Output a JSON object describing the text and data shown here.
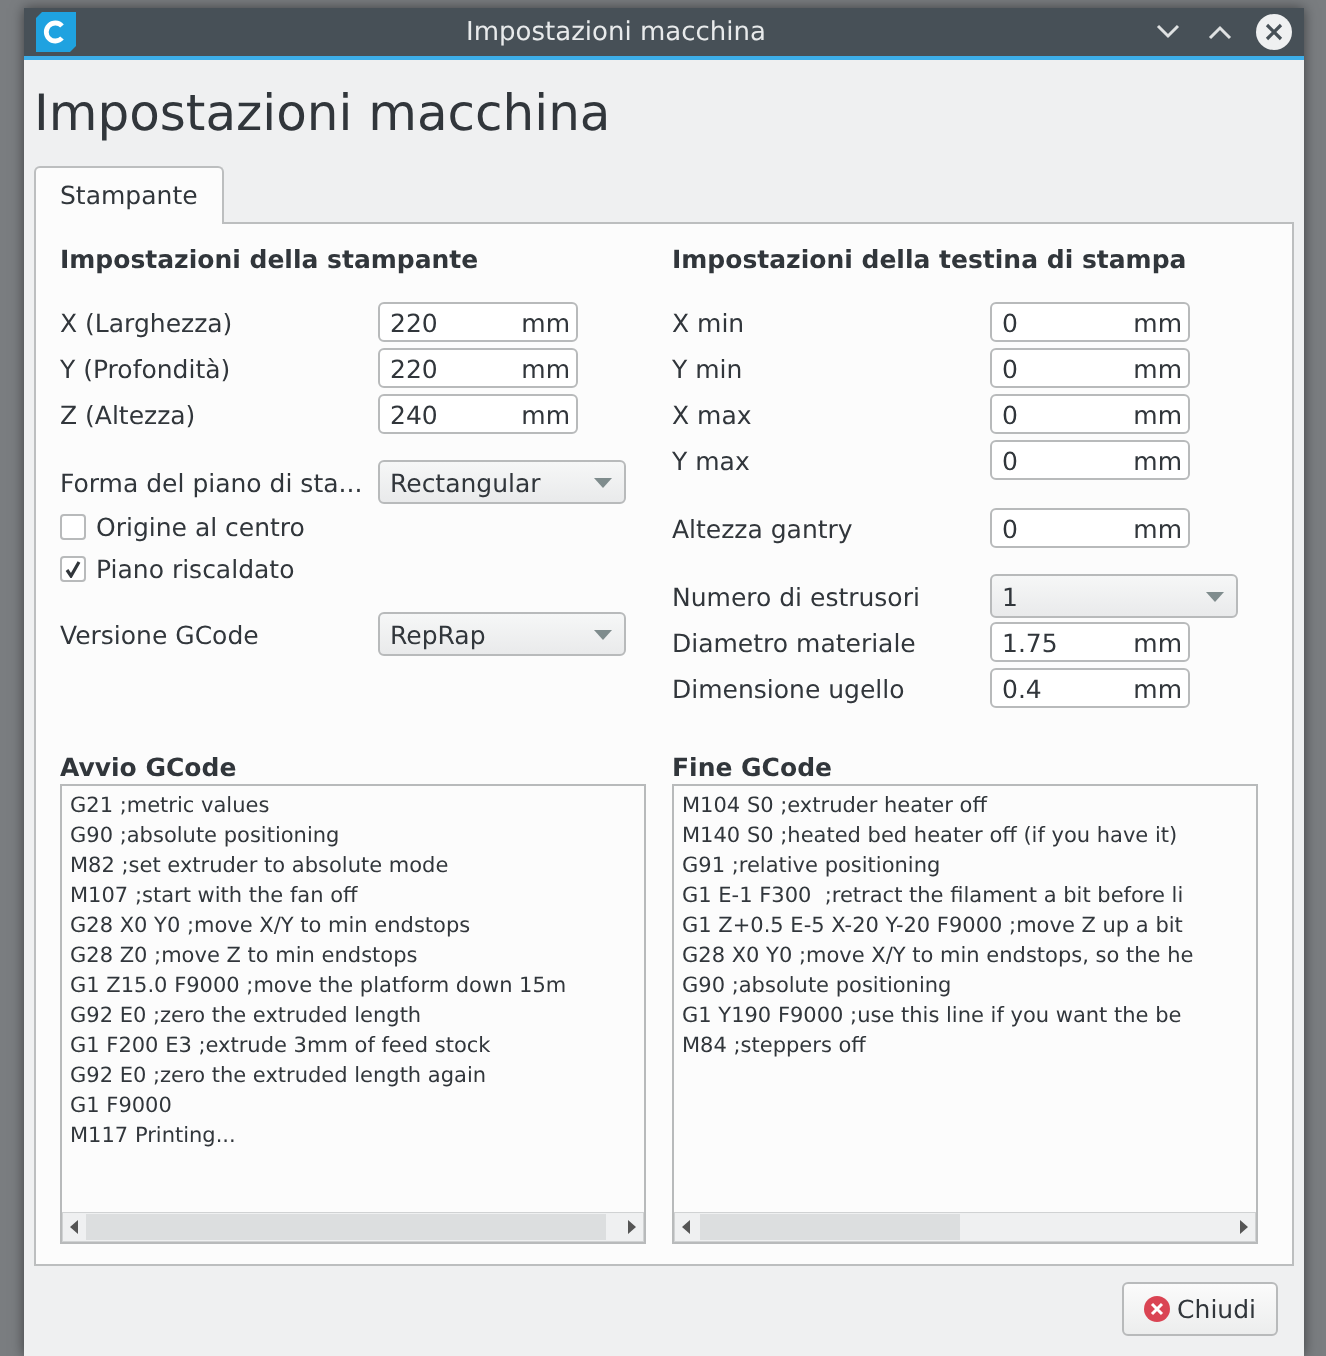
{
  "window": {
    "title": "Impostazioni macchina"
  },
  "heading": "Impostazioni macchina",
  "tabs": [
    {
      "label": "Stampante",
      "selected": true
    }
  ],
  "printer_settings": {
    "title": "Impostazioni della stampante",
    "groups": [
      [
        {
          "kind": "field",
          "label": "X (Larghezza)",
          "value": "220",
          "unit": "mm"
        },
        {
          "kind": "field",
          "label": "Y (Profondità)",
          "value": "220",
          "unit": "mm"
        },
        {
          "kind": "field",
          "label": "Z (Altezza)",
          "value": "240",
          "unit": "mm"
        }
      ],
      [
        {
          "kind": "select",
          "label": "Forma del piano di sta...",
          "value": "Rectangular"
        },
        {
          "kind": "checkbox",
          "label": "Origine al centro",
          "checked": false
        },
        {
          "kind": "checkbox",
          "label": "Piano riscaldato",
          "checked": true
        }
      ],
      [
        {
          "kind": "select",
          "label": "Versione GCode",
          "value": "RepRap"
        }
      ]
    ]
  },
  "printhead_settings": {
    "title": "Impostazioni della testina di stampa",
    "groups": [
      [
        {
          "kind": "field",
          "label": "X min",
          "value": "0",
          "unit": "mm"
        },
        {
          "kind": "field",
          "label": "Y min",
          "value": "0",
          "unit": "mm"
        },
        {
          "kind": "field",
          "label": "X max",
          "value": "0",
          "unit": "mm"
        },
        {
          "kind": "field",
          "label": "Y max",
          "value": "0",
          "unit": "mm"
        }
      ],
      [
        {
          "kind": "field",
          "label": "Altezza gantry",
          "value": "0",
          "unit": "mm"
        }
      ],
      [
        {
          "kind": "select",
          "label": "Numero di estrusori",
          "value": "1"
        },
        {
          "kind": "field",
          "label": "Diametro materiale",
          "value": "1.75",
          "unit": "mm"
        },
        {
          "kind": "field",
          "label": "Dimensione ugello",
          "value": "0.4",
          "unit": "mm"
        }
      ]
    ]
  },
  "start_gcode": {
    "title": "Avvio GCode",
    "lines": [
      "G21 ;metric values",
      "G90 ;absolute positioning",
      "M82 ;set extruder to absolute mode",
      "M107 ;start with the fan off",
      "G28 X0 Y0 ;move X/Y to min endstops",
      "G28 Z0 ;move Z to min endstops",
      "G1 Z15.0 F9000 ;move the platform down 15m",
      "G92 E0 ;zero the extruded length",
      "G1 F200 E3 ;extrude 3mm of feed stock",
      "G92 E0 ;zero the extruded length again",
      "G1 F9000",
      "M117 Printing..."
    ]
  },
  "end_gcode": {
    "title": "Fine GCode",
    "lines": [
      "M104 S0 ;extruder heater off",
      "M140 S0 ;heated bed heater off (if you have it)",
      "G91 ;relative positioning",
      "G1 E-1 F300  ;retract the filament a bit before li",
      "G1 Z+0.5 E-5 X-20 Y-20 F9000 ;move Z up a bit",
      "G28 X0 Y0 ;move X/Y to min endstops, so the he",
      "G90 ;absolute positioning",
      "G1 Y190 F9000 ;use this line if you want the be",
      "M84 ;steppers off"
    ]
  },
  "close_button": "Chiudi"
}
